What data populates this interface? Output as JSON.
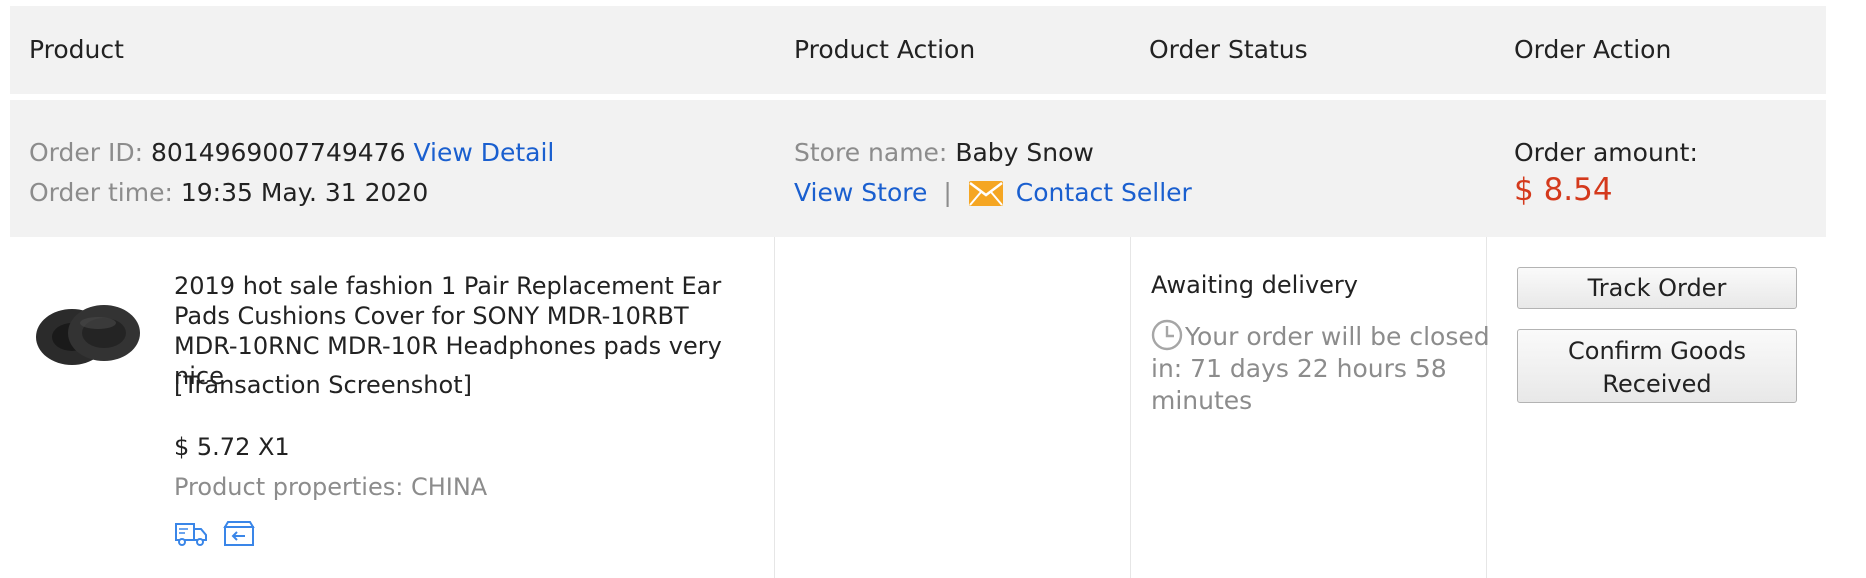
{
  "header": {
    "product": "Product",
    "product_action": "Product Action",
    "order_status": "Order Status",
    "order_action": "Order Action"
  },
  "order": {
    "id_label": "Order ID:",
    "id_value": "8014969007749476",
    "view_detail": "View Detail",
    "time_label": "Order time:",
    "time_value": "19:35 May. 31 2020",
    "store_label": "Store name:",
    "store_value": "Baby Snow",
    "view_store": "View Store",
    "separator": "|",
    "contact_seller": "Contact Seller",
    "amount_label": "Order amount:",
    "amount_value": "$ 8.54"
  },
  "item": {
    "title": "2019 hot sale fashion 1 Pair Replacement Ear Pads Cushions Cover for SONY MDR-10RBT MDR-10RNC MDR-10R Headphones pads very nice",
    "screenshot_link": "[Transaction Screenshot]",
    "price_qty": "$ 5.72 X1",
    "properties": "Product properties: CHINA",
    "icons": [
      "delivery-truck-icon",
      "return-box-icon"
    ]
  },
  "status": {
    "title": "Awaiting delivery",
    "detail": "Your order will be closed in: 71 days 22 hours 58 minutes",
    "icon": "clock-icon"
  },
  "actions": {
    "track_order": "Track Order",
    "confirm_goods": "Confirm Goods Received"
  },
  "colors": {
    "link": "#1a5fcf",
    "amount": "#d4391c",
    "band_bg": "#f2f2f2",
    "muted": "#8c8c8c"
  }
}
